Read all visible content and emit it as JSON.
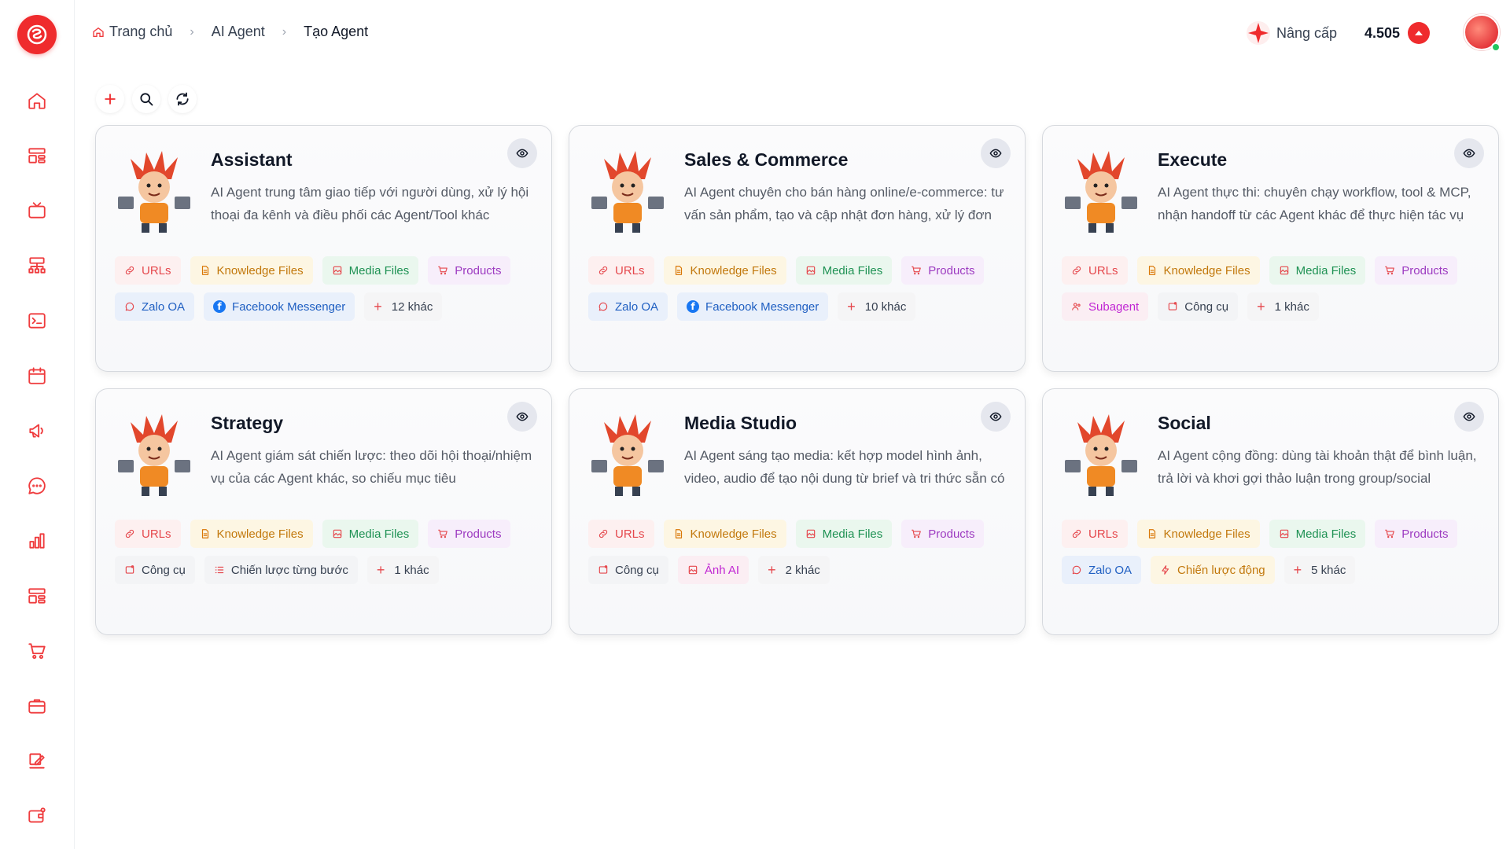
{
  "breadcrumb": [
    "Trang chủ",
    "AI Agent",
    "Tạo Agent"
  ],
  "header": {
    "upgrade_label": "Nâng cấp",
    "credits": "4.505"
  },
  "colors": {
    "brand": "#ef2b2d",
    "online": "#22c55e"
  },
  "sidebar": {
    "icons": [
      "home-icon",
      "dashboard-icon",
      "tv-icon",
      "sitemap-icon",
      "terminal-icon",
      "calendar-icon",
      "megaphone-icon",
      "chat-icon",
      "bar-chart-icon",
      "layout-icon",
      "cart-icon",
      "briefcase-icon",
      "edit-icon",
      "wallet-icon"
    ]
  },
  "toolbar": {
    "icons": [
      "plus-icon",
      "search-icon",
      "refresh-icon"
    ]
  },
  "agents": [
    {
      "title": "Assistant",
      "desc": "AI Agent trung tâm giao tiếp với người dùng, xử lý hội thoại đa kênh và điều phối các Agent/Tool khác",
      "tags": [
        "URLs",
        "Knowledge Files",
        "Media Files",
        "Products",
        "Zalo OA",
        "Facebook Messenger",
        "12 khác"
      ]
    },
    {
      "title": "Sales & Commerce",
      "desc": "AI Agent chuyên cho bán hàng online/e-commerce: tư vấn sản phẩm, tạo và cập nhật đơn hàng, xử lý đơn",
      "tags": [
        "URLs",
        "Knowledge Files",
        "Media Files",
        "Products",
        "Zalo OA",
        "Facebook Messenger",
        "10 khác"
      ]
    },
    {
      "title": "Execute",
      "desc": "AI Agent thực thi: chuyên chạy workflow, tool & MCP, nhận handoff từ các Agent khác để thực hiện tác vụ",
      "tags": [
        "URLs",
        "Knowledge Files",
        "Media Files",
        "Products",
        "Subagent",
        "Công cụ",
        "1 khác"
      ]
    },
    {
      "title": "Strategy",
      "desc": "AI Agent giám sát chiến lược: theo dõi hội thoại/nhiệm vụ của các Agent khác, so chiếu mục tiêu",
      "tags": [
        "URLs",
        "Knowledge Files",
        "Media Files",
        "Products",
        "Công cụ",
        "Chiến lược từng bước",
        "1 khác"
      ]
    },
    {
      "title": "Media Studio",
      "desc": "AI Agent sáng tạo media: kết hợp model hình ảnh, video, audio để tạo nội dung từ brief và tri thức sẵn có",
      "tags": [
        "URLs",
        "Knowledge Files",
        "Media Files",
        "Products",
        "Công cụ",
        "Ảnh AI",
        "2 khác"
      ]
    },
    {
      "title": "Social",
      "desc": "AI Agent cộng đồng: dùng tài khoản thật để bình luận, trả lời và khơi gợi thảo luận trong group/social",
      "tags": [
        "URLs",
        "Knowledge Files",
        "Media Files",
        "Products",
        "Zalo OA",
        "Chiến lược động",
        "5 khác"
      ]
    }
  ]
}
